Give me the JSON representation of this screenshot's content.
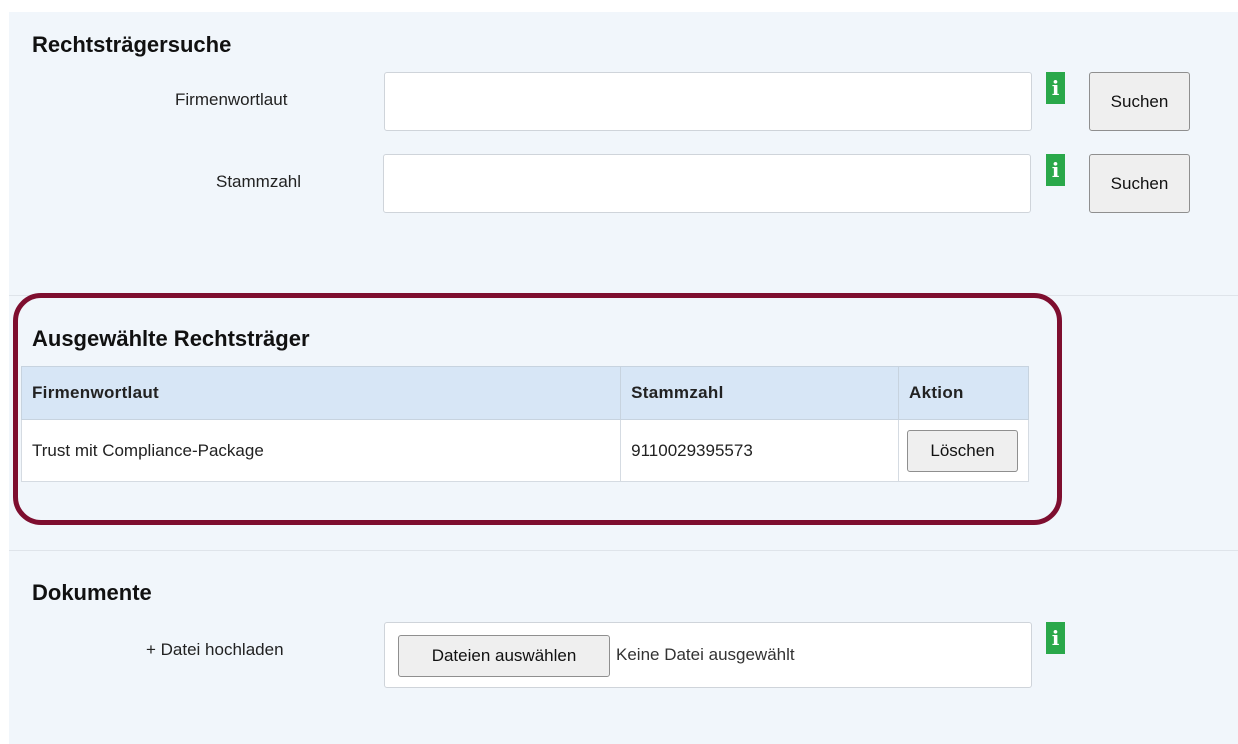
{
  "search": {
    "title": "Rechtsträgersuche",
    "firmenwortlaut_label": "Firmenwortlaut",
    "firmenwortlaut_value": "",
    "stammzahl_label": "Stammzahl",
    "stammzahl_value": "",
    "search_button_label": "Suchen",
    "info_icon": "i"
  },
  "selected": {
    "title": "Ausgewählte Rechtsträger",
    "columns": [
      "Firmenwortlaut",
      "Stammzahl",
      "Aktion"
    ],
    "rows": [
      {
        "firmenwortlaut": "Trust mit Compliance-Package",
        "stammzahl": "9110029395573",
        "action_label": "Löschen"
      }
    ],
    "highlight_color": "#7e0e2f"
  },
  "documents": {
    "title": "Dokumente",
    "upload_label": "+ Datei hochladen",
    "choose_button_label": "Dateien auswählen",
    "file_status": "Keine Datei ausgewählt",
    "info_icon": "i"
  },
  "colors": {
    "panel_bg": "#f1f6fb",
    "table_header_bg": "#d7e6f6",
    "info_badge": "#2aa84a"
  }
}
